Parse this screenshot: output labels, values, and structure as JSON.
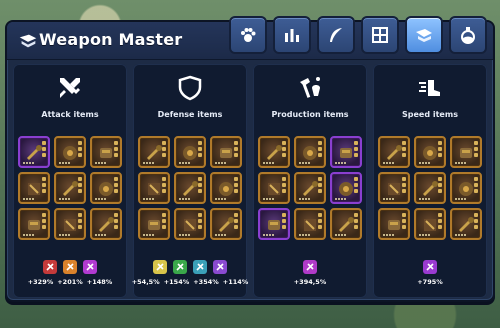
{
  "window": {
    "title": "Weapon Master",
    "title_icon": "paw-scroll-icon"
  },
  "tabs": [
    {
      "name": "paw-icon",
      "active": false
    },
    {
      "name": "bar-chart-icon",
      "active": false
    },
    {
      "name": "feather-icon",
      "active": false
    },
    {
      "name": "map-icon",
      "active": false
    },
    {
      "name": "weapon-master-icon",
      "active": true
    },
    {
      "name": "potion-icon",
      "active": false
    }
  ],
  "columns": [
    {
      "title": "Attack items",
      "icon": "crossed-swords-icon",
      "items": [
        "epic",
        "legendary",
        "legendary",
        "legendary",
        "legendary",
        "legendary",
        "legendary",
        "legendary",
        "legendary"
      ],
      "bonuses": [
        {
          "icon": "sword-icon",
          "color": "#c43a3a",
          "value": "+329%"
        },
        {
          "icon": "dagger-icon",
          "color": "#d9822b",
          "value": "+201%"
        },
        {
          "icon": "crit-icon",
          "color": "#b13ad0",
          "value": "+148%"
        }
      ]
    },
    {
      "title": "Defense items",
      "icon": "shield-icon",
      "items": [
        "legendary",
        "legendary",
        "legendary",
        "legendary",
        "legendary",
        "legendary",
        "legendary",
        "legendary",
        "legendary"
      ],
      "bonuses": [
        {
          "icon": "heal-icon",
          "color": "#d8c44a",
          "value": "+54,5%"
        },
        {
          "icon": "armor-icon",
          "color": "#3aa84a",
          "value": "+154%"
        },
        {
          "icon": "block-icon",
          "color": "#3aa0b8",
          "value": "+354%"
        },
        {
          "icon": "dodge-icon",
          "color": "#8a4ad0",
          "value": "+114%"
        }
      ]
    },
    {
      "title": "Production items",
      "icon": "tools-icon",
      "items": [
        "legendary",
        "legendary",
        "epic",
        "legendary",
        "legendary",
        "epic",
        "epic",
        "legendary",
        "legendary"
      ],
      "bonuses": [
        {
          "icon": "crate-icon",
          "color": "#b03ac8",
          "value": "+394,5%"
        }
      ]
    },
    {
      "title": "Speed items",
      "icon": "winged-boot-icon",
      "items": [
        "legendary",
        "legendary",
        "legendary",
        "legendary",
        "legendary",
        "legendary",
        "legendary",
        "legendary",
        "legendary"
      ],
      "bonuses": [
        {
          "icon": "speed-icon",
          "color": "#9a3ad0",
          "value": "+795%"
        }
      ]
    }
  ],
  "colors": {
    "panel": "#1d2b45",
    "legendary_border": "#b07a2a",
    "epic_border": "#8a3fd0",
    "active_tab": "#8fc3ff"
  }
}
